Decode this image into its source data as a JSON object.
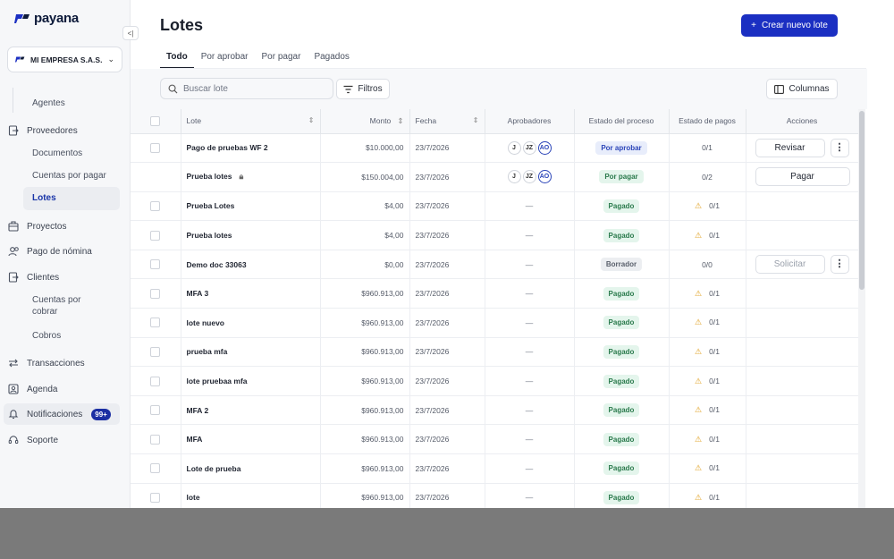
{
  "app": {
    "logo": "payana",
    "company": "MI EMPRESA S.A.S."
  },
  "sidebar": {
    "items": [
      {
        "key": "agentes",
        "label": "Agentes",
        "level": "sub"
      },
      {
        "key": "proveedores",
        "label": "Proveedores",
        "level": "top",
        "icon": "file-arrow-icon"
      },
      {
        "key": "documentos",
        "label": "Documentos",
        "level": "sub"
      },
      {
        "key": "cuentas_pagar",
        "label": "Cuentas por pagar",
        "level": "sub"
      },
      {
        "key": "lotes",
        "label": "Lotes",
        "level": "sub",
        "active": true
      },
      {
        "key": "proyectos",
        "label": "Proyectos",
        "level": "top",
        "icon": "building-icon"
      },
      {
        "key": "nomina",
        "label": "Pago de nómina",
        "level": "top",
        "icon": "users-icon"
      },
      {
        "key": "clientes",
        "label": "Clientes",
        "level": "top",
        "icon": "file-arrow-icon"
      },
      {
        "key": "cuentas_cobrar",
        "label": "Cuentas por cobrar",
        "level": "sub"
      },
      {
        "key": "cobros",
        "label": "Cobros",
        "level": "sub"
      },
      {
        "key": "transacciones",
        "label": "Transacciones",
        "level": "top",
        "icon": "swap-icon"
      },
      {
        "key": "agenda",
        "label": "Agenda",
        "level": "top",
        "icon": "contact-icon"
      },
      {
        "key": "notificaciones",
        "label": "Notificaciones",
        "level": "top",
        "icon": "bell-icon",
        "badge": "99+"
      },
      {
        "key": "soporte",
        "label": "Soporte",
        "level": "top",
        "icon": "headset-icon"
      }
    ]
  },
  "header": {
    "title": "Lotes",
    "create_label": "Crear nuevo lote"
  },
  "tabs": [
    "Todo",
    "Por aprobar",
    "Por pagar",
    "Pagados"
  ],
  "toolbar": {
    "search_placeholder": "Buscar lote",
    "filters_label": "Filtros",
    "columns_label": "Columnas"
  },
  "table": {
    "headers": {
      "lote": "Lote",
      "monto": "Monto",
      "fecha": "Fecha",
      "aprobadores": "Aprobadores",
      "estado_proceso": "Estado del proceso",
      "estado_pagos": "Estado de pagos",
      "acciones": "Acciones"
    },
    "rows": [
      {
        "name": "Pago de pruebas WF 2",
        "amount": "$10.000,00",
        "date": "23/7/2026",
        "approvers": [
          "J",
          "JZ",
          "AO"
        ],
        "status": "Por aprobar",
        "status_kind": "aprobar",
        "payments": "0/1",
        "warn": false,
        "action": "Revisar",
        "kebab": true,
        "checkbox": true
      },
      {
        "name": "Prueba lotes",
        "amount": "$150.004,00",
        "date": "23/7/2026",
        "approvers": [
          "J",
          "JZ",
          "AO"
        ],
        "status": "Por pagar",
        "status_kind": "pagar",
        "payments": "0/2",
        "warn": false,
        "action": "Pagar",
        "kebab": false,
        "checkbox": false,
        "locked": true
      },
      {
        "name": "Prueba Lotes",
        "amount": "$4,00",
        "date": "23/7/2026",
        "approvers": [],
        "status": "Pagado",
        "status_kind": "pagado",
        "payments": "0/1",
        "warn": true,
        "action": "",
        "kebab": false,
        "checkbox": true
      },
      {
        "name": "Prueba lotes",
        "amount": "$4,00",
        "date": "23/7/2026",
        "approvers": [],
        "status": "Pagado",
        "status_kind": "pagado",
        "payments": "0/1",
        "warn": true,
        "action": "",
        "kebab": false,
        "checkbox": true
      },
      {
        "name": "Demo doc 33063",
        "amount": "$0,00",
        "date": "23/7/2026",
        "approvers": [],
        "status": "Borrador",
        "status_kind": "borrador",
        "payments": "0/0",
        "warn": false,
        "action": "Solicitar",
        "action_disabled": true,
        "kebab": true,
        "checkbox": true
      },
      {
        "name": "MFA 3",
        "amount": "$960.913,00",
        "date": "23/7/2026",
        "approvers": [],
        "status": "Pagado",
        "status_kind": "pagado",
        "payments": "0/1",
        "warn": true,
        "action": "",
        "kebab": false,
        "checkbox": true
      },
      {
        "name": "lote nuevo",
        "amount": "$960.913,00",
        "date": "23/7/2026",
        "approvers": [],
        "status": "Pagado",
        "status_kind": "pagado",
        "payments": "0/1",
        "warn": true,
        "action": "",
        "kebab": false,
        "checkbox": true
      },
      {
        "name": "prueba mfa",
        "amount": "$960.913,00",
        "date": "23/7/2026",
        "approvers": [],
        "status": "Pagado",
        "status_kind": "pagado",
        "payments": "0/1",
        "warn": true,
        "action": "",
        "kebab": false,
        "checkbox": true
      },
      {
        "name": "lote pruebaa mfa",
        "amount": "$960.913,00",
        "date": "23/7/2026",
        "approvers": [],
        "status": "Pagado",
        "status_kind": "pagado",
        "payments": "0/1",
        "warn": true,
        "action": "",
        "kebab": false,
        "checkbox": true
      },
      {
        "name": "MFA 2",
        "amount": "$960.913,00",
        "date": "23/7/2026",
        "approvers": [],
        "status": "Pagado",
        "status_kind": "pagado",
        "payments": "0/1",
        "warn": true,
        "action": "",
        "kebab": false,
        "checkbox": true
      },
      {
        "name": "MFA",
        "amount": "$960.913,00",
        "date": "23/7/2026",
        "approvers": [],
        "status": "Pagado",
        "status_kind": "pagado",
        "payments": "0/1",
        "warn": true,
        "action": "",
        "kebab": false,
        "checkbox": true
      },
      {
        "name": "Lote de prueba",
        "amount": "$960.913,00",
        "date": "23/7/2026",
        "approvers": [],
        "status": "Pagado",
        "status_kind": "pagado",
        "payments": "0/1",
        "warn": true,
        "action": "",
        "kebab": false,
        "checkbox": true
      },
      {
        "name": "lote",
        "amount": "$960.913,00",
        "date": "23/7/2026",
        "approvers": [],
        "status": "Pagado",
        "status_kind": "pagado",
        "payments": "0/1",
        "warn": true,
        "action": "",
        "kebab": false,
        "checkbox": true
      }
    ],
    "empty_approvers": "—"
  },
  "colors": {
    "brand": "#1b2fc2",
    "active_nav": "#1935a8",
    "warning": "#e0a020"
  }
}
